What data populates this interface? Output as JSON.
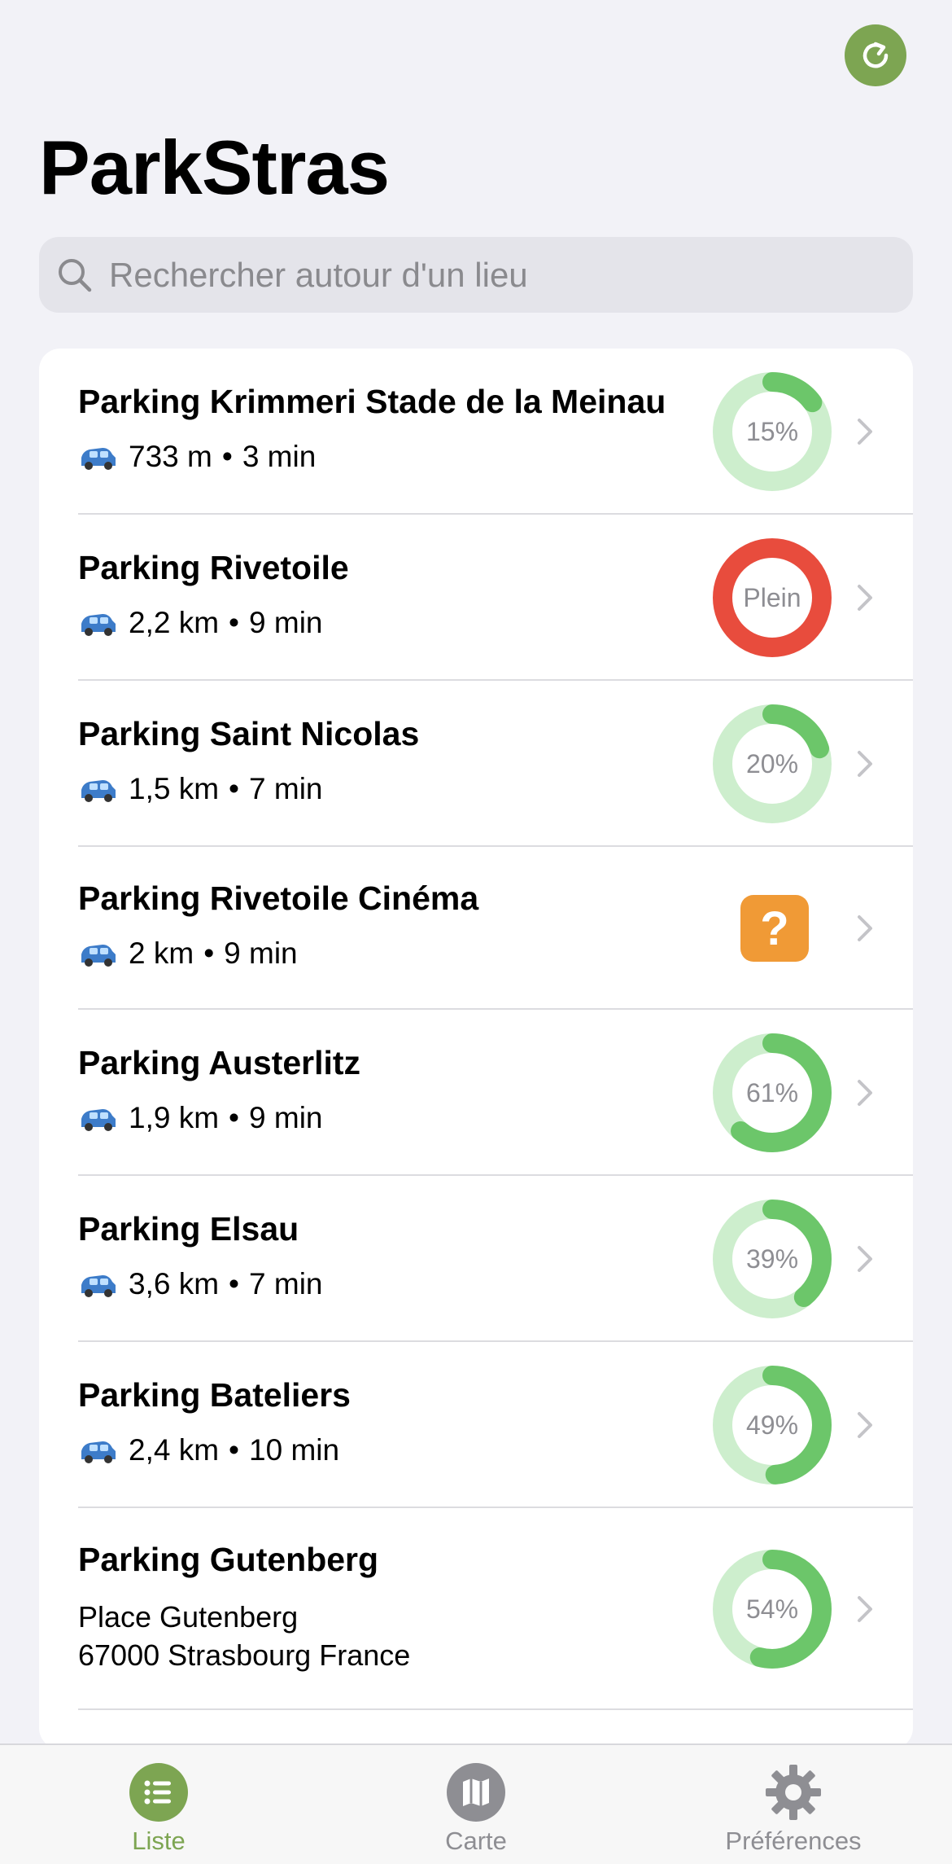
{
  "app": {
    "title": "ParkStras"
  },
  "search": {
    "placeholder": "Rechercher autour d'un lieu"
  },
  "parkings": [
    {
      "name": "Parking Krimmeri Stade de la Meinau",
      "distance": "733 m",
      "time": "3 min",
      "status": "percent",
      "occupancy_label": "15%",
      "fill": 0.15,
      "color": "#6cc66a"
    },
    {
      "name": "Parking Rivetoile",
      "distance": "2,2 km",
      "time": "9 min",
      "status": "full",
      "occupancy_label": "Plein",
      "fill": 1.0,
      "color": "#e84c3d"
    },
    {
      "name": "Parking Saint Nicolas",
      "distance": "1,5 km",
      "time": "7 min",
      "status": "percent",
      "occupancy_label": "20%",
      "fill": 0.2,
      "color": "#6cc66a"
    },
    {
      "name": "Parking Rivetoile Cinéma",
      "distance": "2 km",
      "time": "9 min",
      "status": "unknown",
      "occupancy_label": "?",
      "fill": 0,
      "color": "#f09a36"
    },
    {
      "name": "Parking Austerlitz",
      "distance": "1,9 km",
      "time": "9 min",
      "status": "percent",
      "occupancy_label": "61%",
      "fill": 0.61,
      "color": "#6cc66a"
    },
    {
      "name": "Parking Elsau",
      "distance": "3,6 km",
      "time": "7 min",
      "status": "percent",
      "occupancy_label": "39%",
      "fill": 0.39,
      "color": "#6cc66a"
    },
    {
      "name": "Parking Bateliers",
      "distance": "2,4 km",
      "time": "10 min",
      "status": "percent",
      "occupancy_label": "49%",
      "fill": 0.49,
      "color": "#6cc66a"
    },
    {
      "name": "Parking Gutenberg",
      "address_line1": "Place Gutenberg",
      "address_line2": "67000 Strasbourg France",
      "status": "percent",
      "occupancy_label": "54%",
      "fill": 0.54,
      "color": "#6cc66a"
    }
  ],
  "tabs": [
    {
      "label": "Liste",
      "icon": "list-icon",
      "active": true
    },
    {
      "label": "Carte",
      "icon": "map-icon",
      "active": false
    },
    {
      "label": "Préférences",
      "icon": "gear-icon",
      "active": false
    }
  ],
  "colors": {
    "accent": "#7da552",
    "ring_track": "#cdeecd",
    "full": "#e84c3d",
    "unknown": "#f09a36"
  }
}
